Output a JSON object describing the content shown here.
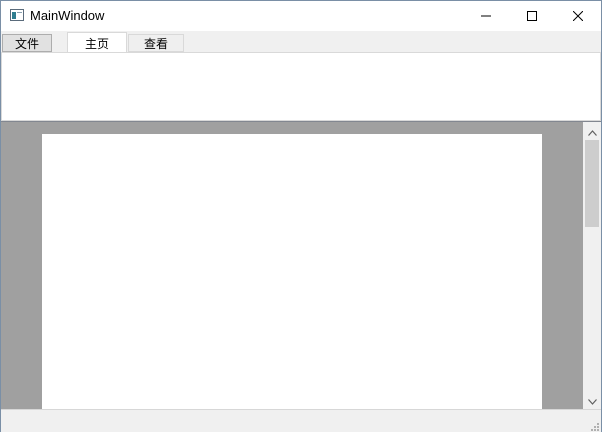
{
  "window": {
    "title": "MainWindow"
  },
  "titlebar": {
    "minimize_icon": "minimize-icon",
    "maximize_icon": "maximize-icon",
    "close_icon": "close-icon"
  },
  "ribbon": {
    "tabs": [
      {
        "label": "文件",
        "active": false
      },
      {
        "label": "主页",
        "active": true
      },
      {
        "label": "查看",
        "active": false
      }
    ]
  },
  "colors": {
    "doc_background": "#a0a0a0",
    "page": "#ffffff",
    "chrome": "#f0f0f0"
  }
}
